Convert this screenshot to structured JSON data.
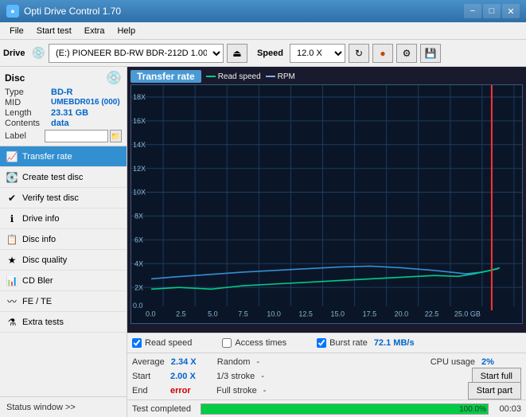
{
  "window": {
    "title": "Opti Drive Control 1.70",
    "min_label": "−",
    "max_label": "□",
    "close_label": "✕"
  },
  "menu": {
    "items": [
      "File",
      "Start test",
      "Extra",
      "Help"
    ]
  },
  "toolbar": {
    "drive_label": "Drive",
    "drive_value": "(E:) PIONEER BD-RW  BDR-212D 1.00",
    "speed_label": "Speed",
    "speed_value": "12.0 X ▼"
  },
  "disc": {
    "title": "Disc",
    "type_label": "Type",
    "type_value": "BD-R",
    "mid_label": "MID",
    "mid_value": "UMEBDR016 (000)",
    "length_label": "Length",
    "length_value": "23.31 GB",
    "contents_label": "Contents",
    "contents_value": "data",
    "label_label": "Label",
    "label_value": ""
  },
  "nav": {
    "items": [
      {
        "id": "transfer-rate",
        "label": "Transfer rate",
        "active": true
      },
      {
        "id": "create-test-disc",
        "label": "Create test disc",
        "active": false
      },
      {
        "id": "verify-test-disc",
        "label": "Verify test disc",
        "active": false
      },
      {
        "id": "drive-info",
        "label": "Drive info",
        "active": false
      },
      {
        "id": "disc-info",
        "label": "Disc info",
        "active": false
      },
      {
        "id": "disc-quality",
        "label": "Disc quality",
        "active": false
      },
      {
        "id": "cd-bler",
        "label": "CD Bler",
        "active": false
      },
      {
        "id": "fe-te",
        "label": "FE / TE",
        "active": false
      },
      {
        "id": "extra-tests",
        "label": "Extra tests",
        "active": false
      }
    ],
    "status_window": "Status window >> "
  },
  "chart": {
    "title": "Transfer rate",
    "legend": [
      {
        "label": "Read speed",
        "color": "#00cc88"
      },
      {
        "label": "RPM",
        "color": "#88aaff"
      }
    ],
    "y_axis": [
      "18X",
      "16X",
      "14X",
      "12X",
      "10X",
      "8X",
      "6X",
      "4X",
      "2X",
      "0.0"
    ],
    "x_axis": [
      "0.0",
      "2.5",
      "5.0",
      "7.5",
      "10.0",
      "12.5",
      "15.0",
      "17.5",
      "20.0",
      "22.5",
      "25.0 GB"
    ],
    "grid_color": "#1e3a5a",
    "burst_line_color": "#ff4444",
    "burst_x_pos": "95%"
  },
  "checkboxes": {
    "read_speed_checked": true,
    "read_speed_label": "Read speed",
    "access_times_checked": false,
    "access_times_label": "Access times",
    "burst_rate_checked": true,
    "burst_rate_label": "Burst rate",
    "burst_rate_value": "72.1 MB/s"
  },
  "stats": {
    "average_label": "Average",
    "average_value": "2.34 X",
    "random_label": "Random",
    "random_value": "-",
    "cpu_label": "CPU usage",
    "cpu_value": "2%",
    "start_label": "Start",
    "start_value": "2.00 X",
    "stroke1_label": "1/3 stroke",
    "stroke1_value": "-",
    "start_full_label": "Start full",
    "end_label": "End",
    "end_value": "error",
    "stroke2_label": "Full stroke",
    "stroke2_value": "-",
    "start_part_label": "Start part"
  },
  "progress": {
    "status_text": "Test completed",
    "percent": 100,
    "percent_label": "100.0%",
    "timer": "00:03"
  }
}
